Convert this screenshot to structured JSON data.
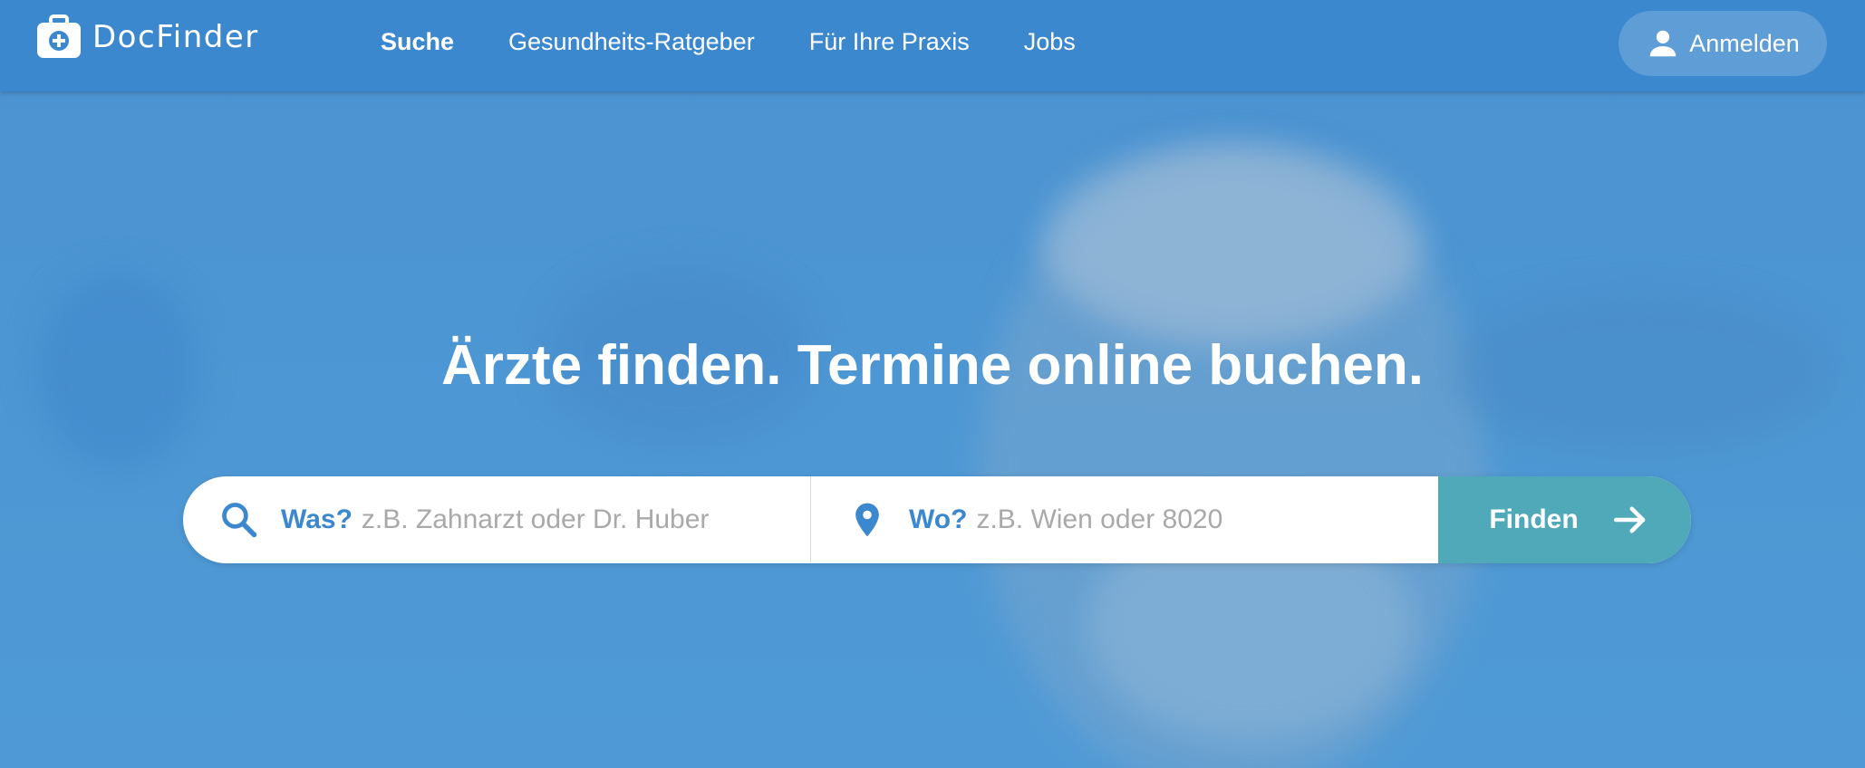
{
  "brand": {
    "name_first": "Doc",
    "name_second": "Finder"
  },
  "nav": {
    "items": [
      {
        "label": "Suche",
        "active": true
      },
      {
        "label": "Gesundheits-Ratgeber"
      },
      {
        "label": "Für Ihre Praxis"
      },
      {
        "label": "Jobs"
      }
    ]
  },
  "header": {
    "login_label": "Anmelden"
  },
  "hero": {
    "headline": "Ärzte finden. Termine online buchen.",
    "search": {
      "what_label": "Was?",
      "what_placeholder": "z.B. Zahnarzt oder Dr. Huber",
      "where_label": "Wo?",
      "where_placeholder": "z.B. Wien oder 8020",
      "submit_label": "Finden"
    }
  },
  "colors": {
    "header_bg": "#3c88cf",
    "hero_bg": "#4b92d1",
    "accent_label": "#3c88cf",
    "button_bg": "#4fa9b9"
  },
  "icons": [
    "medical-bag-icon",
    "user-icon",
    "search-icon",
    "location-pin-icon",
    "arrow-right-icon"
  ]
}
